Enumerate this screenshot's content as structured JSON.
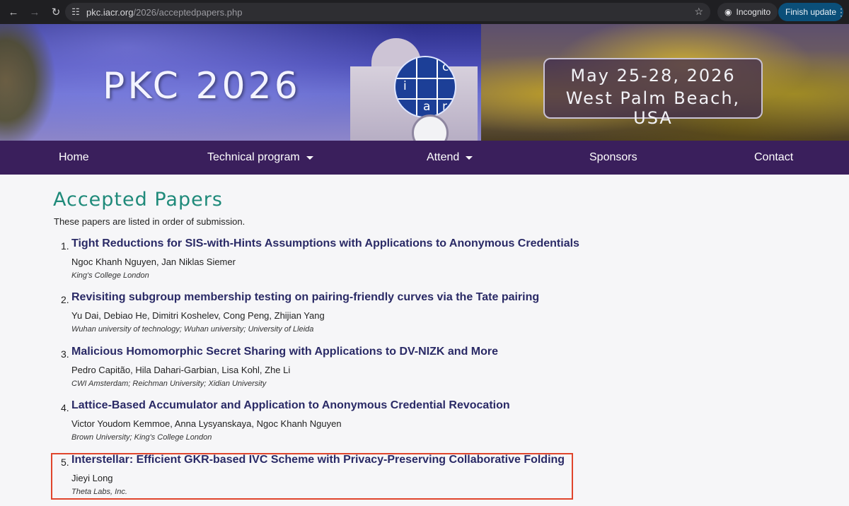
{
  "browser": {
    "url_domain": "pkc.iacr.org",
    "url_path": "/2026/acceptedpapers.php",
    "incognito_label": "Incognito",
    "finish_update_label": "Finish update",
    "icons": [
      "back-arrow-icon",
      "forward-arrow-icon",
      "reload-icon",
      "site-settings-icon",
      "bookmark-star-icon",
      "incognito-icon",
      "more-icon"
    ]
  },
  "banner": {
    "event_title": "PKC 2026",
    "logo_letters": [
      "i",
      "a",
      "c",
      "r"
    ],
    "date_line1": "May 25-28, 2026",
    "date_line2": "West Palm Beach, USA"
  },
  "nav": {
    "items": [
      {
        "label": "Home",
        "dropdown": false
      },
      {
        "label": "Technical program",
        "dropdown": true
      },
      {
        "label": "Attend",
        "dropdown": true
      },
      {
        "label": "Sponsors",
        "dropdown": false
      },
      {
        "label": "Contact",
        "dropdown": false
      }
    ]
  },
  "main": {
    "title": "Accepted Papers",
    "intro": "These papers are listed in order of submission.",
    "papers": [
      {
        "num": "1.",
        "title": "Tight Reductions for SIS-with-Hints Assumptions with Applications to Anonymous Credentials",
        "authors": "Ngoc Khanh Nguyen, Jan Niklas Siemer",
        "affiliation": "King's College London"
      },
      {
        "num": "2.",
        "title": "Revisiting subgroup membership testing on pairing-friendly curves via the Tate pairing",
        "authors": "Yu Dai, Debiao He, Dimitri Koshelev, Cong Peng, Zhijian Yang",
        "affiliation": "Wuhan university of technology; Wuhan university; University of Lleida"
      },
      {
        "num": "3.",
        "title": "Malicious Homomorphic Secret Sharing with Applications to DV-NIZK and More",
        "authors": "Pedro Capitão, Hila Dahari-Garbian, Lisa Kohl, Zhe Li",
        "affiliation": "CWI Amsterdam; Reichman University; Xidian University"
      },
      {
        "num": "4.",
        "title": "Lattice-Based Accumulator and Application to Anonymous Credential Revocation",
        "authors": "Victor Youdom Kemmoe, Anna Lysyanskaya, Ngoc Khanh Nguyen",
        "affiliation": "Brown University; King's College London"
      },
      {
        "num": "5.",
        "title": "Interstellar: Efficient GKR-based IVC Scheme with Privacy-Preserving Collaborative Folding",
        "authors": "Jieyi Long",
        "affiliation": "Theta Labs, Inc."
      }
    ]
  },
  "colors": {
    "nav_bg": "#3a1f5c",
    "title_teal": "#1f8a7a",
    "paper_title": "#2a2a66",
    "highlight_red": "#e0452c"
  }
}
